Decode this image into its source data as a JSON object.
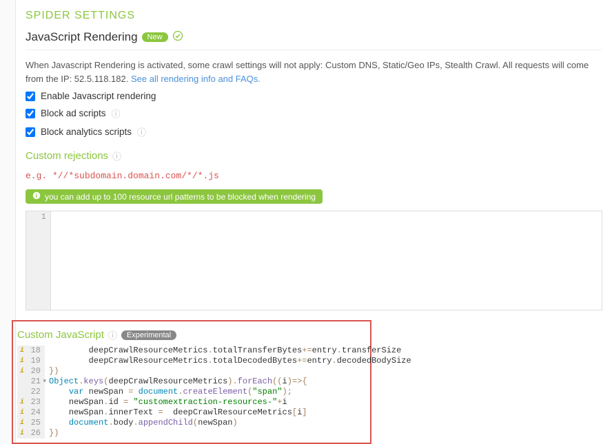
{
  "panelTitle": "SPIDER SETTINGS",
  "section": {
    "title": "JavaScript Rendering",
    "badge": "New"
  },
  "note": {
    "text": "When Javascript Rendering is activated, some crawl settings will not apply: Custom DNS, Static/Geo IPs, Stealth Crawl. All requests will come from the IP: 52.5.118.182. ",
    "linkText": "See all rendering info and FAQs."
  },
  "checks": {
    "enable": "Enable Javascript rendering",
    "blockAds": "Block ad scripts",
    "blockAnalytics": "Block analytics scripts"
  },
  "customRejections": {
    "title": "Custom rejections",
    "example": "e.g. *//*subdomain.domain.com/*/*.js",
    "hint": "you can add up to 100 resource url patterns to be blocked when rendering",
    "line1": "1"
  },
  "customJs": {
    "title": "Custom JavaScript",
    "badge": "Experimental",
    "lines": [
      {
        "n": "18",
        "w": true,
        "indent": "        ",
        "parts": [
          [
            "prop",
            "deepCrawlResourceMetrics"
          ],
          [
            "op",
            "."
          ],
          [
            "prop",
            "totalTransferBytes"
          ],
          [
            "op",
            "+="
          ],
          [
            "prop",
            "entry"
          ],
          [
            "op",
            "."
          ],
          [
            "prop",
            "transferSize"
          ]
        ]
      },
      {
        "n": "19",
        "w": true,
        "indent": "        ",
        "parts": [
          [
            "prop",
            "deepCrawlResourceMetrics"
          ],
          [
            "op",
            "."
          ],
          [
            "prop",
            "totalDecodedBytes"
          ],
          [
            "op",
            "+="
          ],
          [
            "prop",
            "entry"
          ],
          [
            "op",
            "."
          ],
          [
            "prop",
            "decodedBodySize"
          ]
        ]
      },
      {
        "n": "20",
        "w": true,
        "indent": "",
        "parts": [
          [
            "op",
            "})"
          ]
        ]
      },
      {
        "n": "21",
        "w": false,
        "fold": true,
        "indent": "",
        "parts": [
          [
            "obj",
            "Object"
          ],
          [
            "op",
            "."
          ],
          [
            "fn",
            "keys"
          ],
          [
            "op",
            "("
          ],
          [
            "prop",
            "deepCrawlResourceMetrics"
          ],
          [
            "op",
            ")."
          ],
          [
            "fn",
            "forEach"
          ],
          [
            "op",
            "(("
          ],
          [
            "prop",
            "i"
          ],
          [
            "op",
            ")"
          ],
          [
            "arrow",
            "=>"
          ],
          [
            "op",
            "{"
          ]
        ]
      },
      {
        "n": "22",
        "w": false,
        "indent": "    ",
        "parts": [
          [
            "var",
            "var"
          ],
          [
            "prop",
            " newSpan "
          ],
          [
            "op",
            "= "
          ],
          [
            "obj",
            "document"
          ],
          [
            "op",
            "."
          ],
          [
            "fn",
            "createElement"
          ],
          [
            "op",
            "("
          ],
          [
            "str",
            "\"span\""
          ],
          [
            "op",
            ");"
          ]
        ]
      },
      {
        "n": "23",
        "w": true,
        "indent": "    ",
        "parts": [
          [
            "prop",
            "newSpan"
          ],
          [
            "op",
            "."
          ],
          [
            "prop",
            "id "
          ],
          [
            "op",
            "= "
          ],
          [
            "str",
            "\"customextraction-resources-\""
          ],
          [
            "op",
            "+"
          ],
          [
            "prop",
            "i"
          ]
        ]
      },
      {
        "n": "24",
        "w": true,
        "indent": "    ",
        "parts": [
          [
            "prop",
            "newSpan"
          ],
          [
            "op",
            "."
          ],
          [
            "prop",
            "innerText "
          ],
          [
            "op",
            "= "
          ],
          [
            "prop",
            " deepCrawlResourceMetrics"
          ],
          [
            "op",
            "["
          ],
          [
            "prop",
            "i"
          ],
          [
            "op",
            "]"
          ]
        ]
      },
      {
        "n": "25",
        "w": true,
        "indent": "    ",
        "parts": [
          [
            "obj",
            "document"
          ],
          [
            "op",
            "."
          ],
          [
            "prop",
            "body"
          ],
          [
            "op",
            "."
          ],
          [
            "fn",
            "appendChild"
          ],
          [
            "op",
            "("
          ],
          [
            "prop",
            "newSpan"
          ],
          [
            "op",
            ")"
          ]
        ]
      },
      {
        "n": "26",
        "w": true,
        "indent": "",
        "parts": [
          [
            "op",
            "})"
          ]
        ]
      }
    ]
  }
}
